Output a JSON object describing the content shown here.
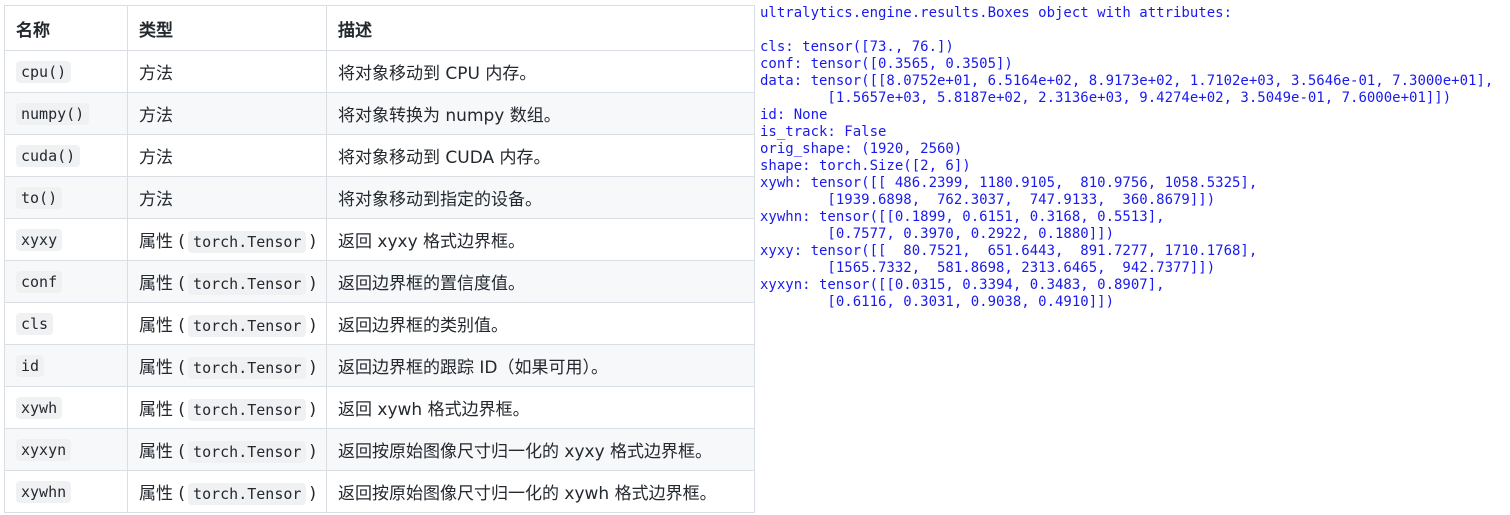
{
  "table": {
    "headers": [
      "名称",
      "类型",
      "描述"
    ],
    "attr_prefix": "属性 (",
    "attr_suffix": ")",
    "rows": [
      {
        "name": "cpu()",
        "type": "方法",
        "type_code": "",
        "desc": "将对象移动到 CPU 内存。"
      },
      {
        "name": "numpy()",
        "type": "方法",
        "type_code": "",
        "desc": "将对象转换为 numpy 数组。"
      },
      {
        "name": "cuda()",
        "type": "方法",
        "type_code": "",
        "desc": "将对象移动到 CUDA 内存。"
      },
      {
        "name": "to()",
        "type": "方法",
        "type_code": "",
        "desc": "将对象移动到指定的设备。"
      },
      {
        "name": "xyxy",
        "type": "属性",
        "type_code": "torch.Tensor",
        "desc": "返回 xyxy 格式边界框。"
      },
      {
        "name": "conf",
        "type": "属性",
        "type_code": "torch.Tensor",
        "desc": "返回边界框的置信度值。"
      },
      {
        "name": "cls",
        "type": "属性",
        "type_code": "torch.Tensor",
        "desc": "返回边界框的类别值。"
      },
      {
        "name": "id",
        "type": "属性",
        "type_code": "torch.Tensor",
        "desc": "返回边界框的跟踪 ID（如果可用）。"
      },
      {
        "name": "xywh",
        "type": "属性",
        "type_code": "torch.Tensor",
        "desc": "返回 xywh 格式边界框。"
      },
      {
        "name": "xyxyn",
        "type": "属性",
        "type_code": "torch.Tensor",
        "desc": "返回按原始图像尺寸归一化的 xyxy 格式边界框。"
      },
      {
        "name": "xywhn",
        "type": "属性",
        "type_code": "torch.Tensor",
        "desc": "返回按原始图像尺寸归一化的 xywh 格式边界框。"
      }
    ]
  },
  "console": {
    "lines": [
      "ultralytics.engine.results.Boxes object with attributes:",
      "",
      "cls: tensor([73., 76.])",
      "conf: tensor([0.3565, 0.3505])",
      "data: tensor([[8.0752e+01, 6.5164e+02, 8.9173e+02, 1.7102e+03, 3.5646e-01, 7.3000e+01],",
      "        [1.5657e+03, 5.8187e+02, 2.3136e+03, 9.4274e+02, 3.5049e-01, 7.6000e+01]])",
      "id: None",
      "is_track: False",
      "orig_shape: (1920, 2560)",
      "shape: torch.Size([2, 6])",
      "xywh: tensor([[ 486.2399, 1180.9105,  810.9756, 1058.5325],",
      "        [1939.6898,  762.3037,  747.9133,  360.8679]])",
      "xywhn: tensor([[0.1899, 0.6151, 0.3168, 0.5513],",
      "        [0.7577, 0.3970, 0.2922, 0.1880]])",
      "xyxy: tensor([[  80.7521,  651.6443,  891.7277, 1710.1768],",
      "        [1565.7332,  581.8698, 2313.6465,  942.7377]])",
      "xyxyn: tensor([[0.0315, 0.3394, 0.3483, 0.8907],",
      "        [0.6116, 0.3031, 0.9038, 0.4910]])"
    ]
  }
}
